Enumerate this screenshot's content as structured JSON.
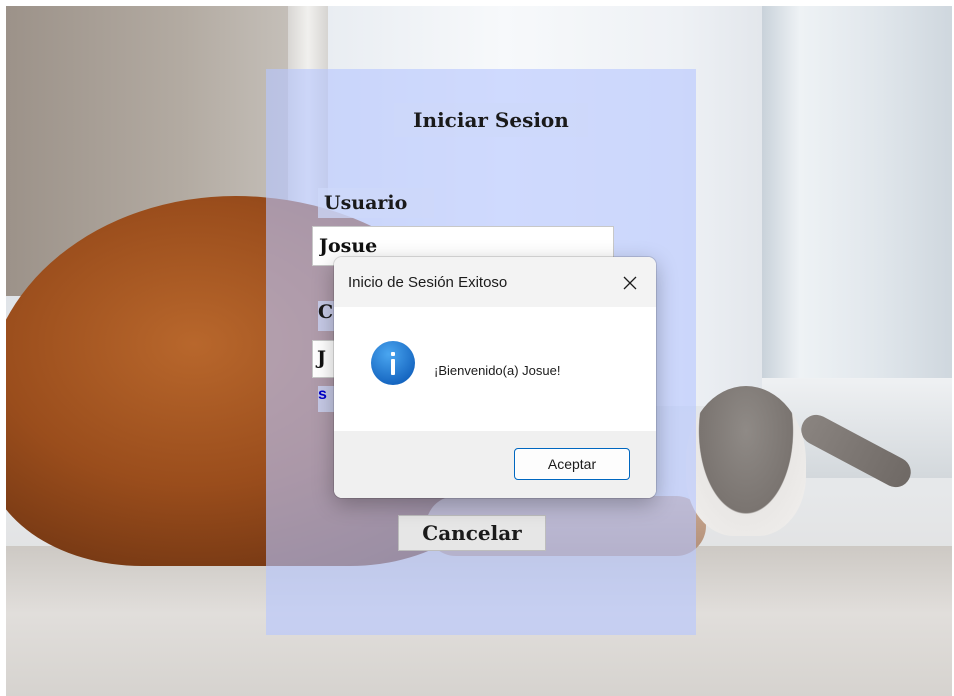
{
  "login": {
    "title": "Iniciar Sesion",
    "username_label": "Usuario",
    "username_value": "Josue",
    "password_label_fragment": "C",
    "password_value_fragment": "J",
    "show_password_fragment": "s",
    "cancel_label": "Cancelar"
  },
  "dialog": {
    "title": "Inicio de Sesión Exitoso",
    "message": "¡Bienvenido(a) Josue!",
    "ok_label": "Aceptar",
    "icon": "info-icon",
    "icon_color": "#1a7fd6"
  }
}
